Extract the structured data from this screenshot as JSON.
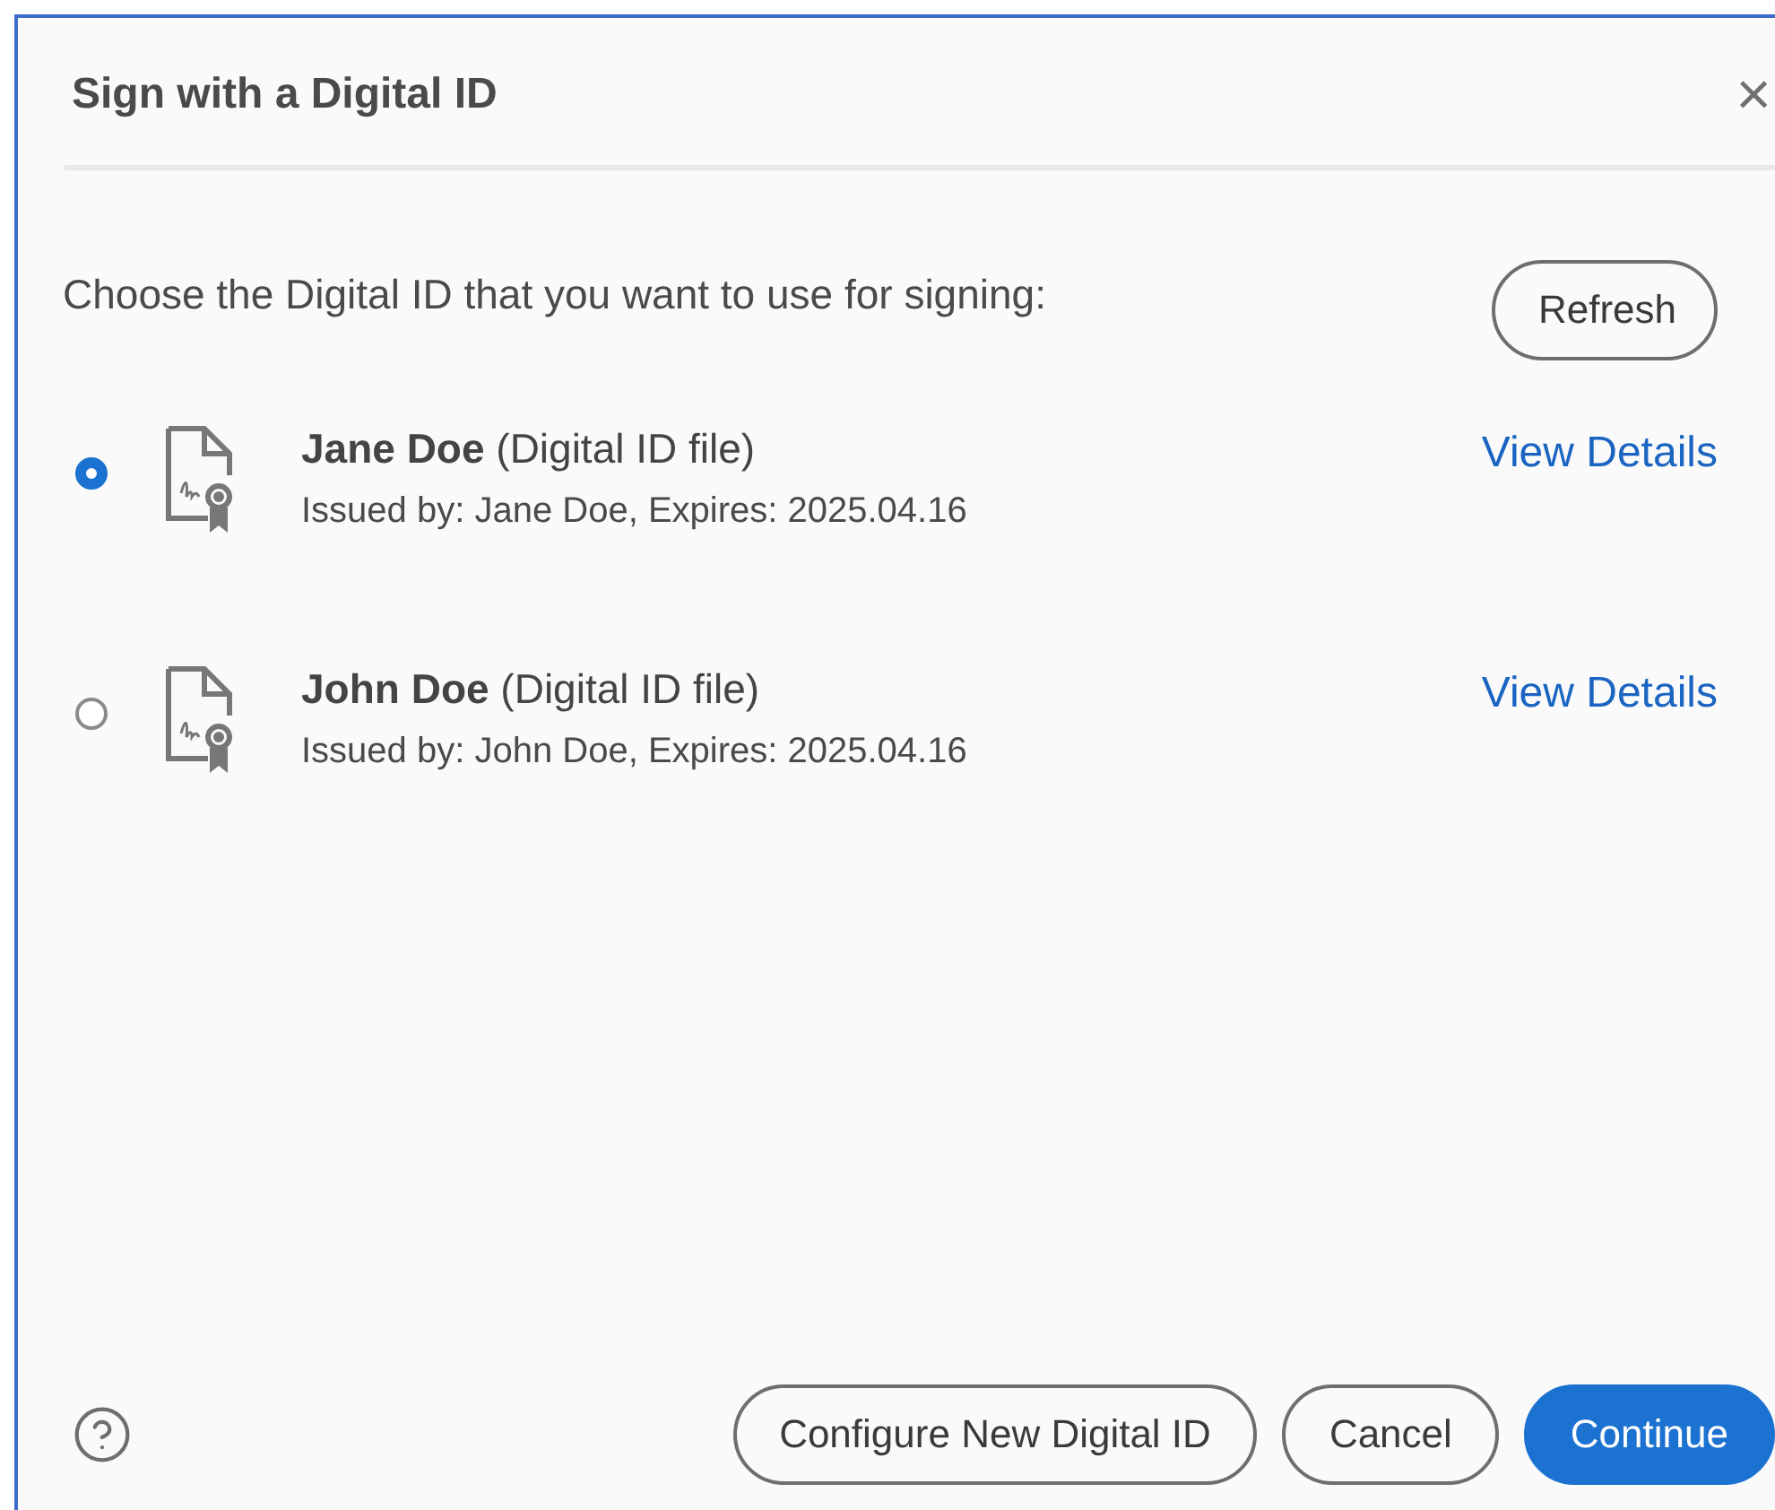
{
  "dialog": {
    "title": "Sign with a Digital ID",
    "close": "×"
  },
  "prompt": "Choose the Digital ID that you want to use for signing:",
  "refresh": "Refresh",
  "ids": [
    {
      "name": "**Jane Doe** (Digital ID file)",
      "issued": "Issued by: Jane Doe, Expires: 2025.04.16",
      "link": "View Details",
      "selected": true
    },
    {
      "name": "**John Doe** (Digital ID file)",
      "issued": "Issued by: John Doe, Expires: 2025.04.16",
      "link": "View Details",
      "selected": false
    }
  ],
  "buttons": [
    {
      "label": "Configure New Digital ID",
      "kind": "secondary"
    },
    {
      "label": "Cancel",
      "kind": "secondary"
    },
    {
      "label": "Continue",
      "kind": "primary"
    }
  ]
}
